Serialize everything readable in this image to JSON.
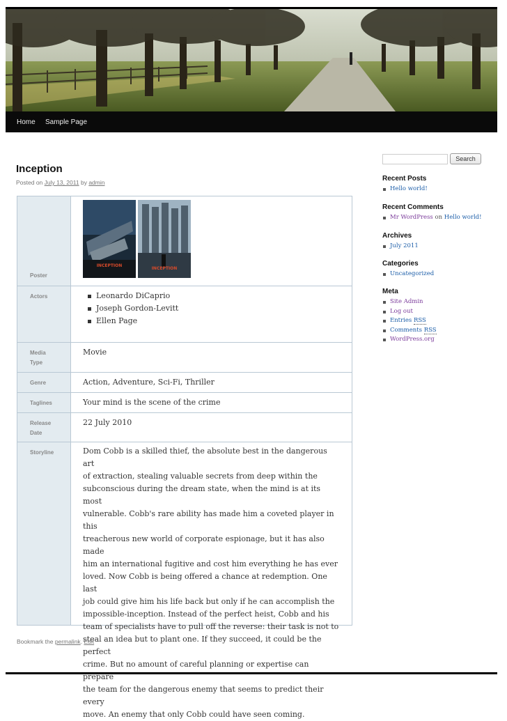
{
  "nav": {
    "items": [
      "Home",
      "Sample Page"
    ]
  },
  "post": {
    "title": "Inception",
    "posted_on": "Posted on",
    "date": "July 13, 2011",
    "by": "by",
    "author": "admin"
  },
  "movie": {
    "labels": {
      "poster": "Poster",
      "actors": "Actors",
      "media_type_1": "Media",
      "media_type_2": "Type",
      "genre": "Genre",
      "taglines": "Taglines",
      "release_1": "Release",
      "release_2": "Date",
      "storyline": "Storyline"
    },
    "poster1_text": "INCEPTION",
    "poster2_text": "INCEPTION",
    "actors": [
      "Leonardo DiCaprio",
      "Joseph Gordon-Levitt",
      "Ellen Page"
    ],
    "media_type": "Movie",
    "genre": "Action, Adventure, Sci-Fi, Thriller",
    "tagline": "Your mind is the scene of the crime",
    "release_date": "22 July 2010",
    "storyline_lines": [
      "Dom Cobb is a skilled thief, the absolute best in the dangerous art",
      "of extraction, stealing valuable secrets from deep within the",
      "subconscious during the dream state, when the mind is at its most",
      "vulnerable. Cobb's rare ability has made him a coveted player in this",
      "treacherous new world of corporate espionage, but it has also made",
      "him an international fugitive and cost him everything he has ever",
      "loved. Now Cobb is being offered a chance at redemption. One last",
      "job could give him his life back but only if he can accomplish the",
      "impossible-inception. Instead of the perfect heist, Cobb and his",
      "team of specialists have to pull off the reverse: their task is not to",
      "steal an idea but to plant one. If they succeed, it could be the perfect",
      "crime. But no amount of careful planning or expertise can prepare",
      "the team for the dangerous enemy that seems to predict their every",
      "move. An enemy that only Cobb could have seen coming."
    ]
  },
  "footer": {
    "bookmark": "Bookmark the",
    "permalink": "permalink",
    "sep": ".",
    "edit": "Edit"
  },
  "sidebar": {
    "search_button": "Search",
    "recent_posts": {
      "title": "Recent Posts",
      "items": [
        "Hello world!"
      ]
    },
    "recent_comments": {
      "title": "Recent Comments",
      "author": "Mr WordPress",
      "on": "on",
      "post": "Hello world!"
    },
    "archives": {
      "title": "Archives",
      "items": [
        "July 2011"
      ]
    },
    "categories": {
      "title": "Categories",
      "items": [
        "Uncategorized"
      ]
    },
    "meta": {
      "title": "Meta",
      "site_admin": "Site Admin",
      "log_out": "Log out",
      "entries": "Entries",
      "comments": "Comments",
      "rss": "RSS",
      "wordpress": "WordPress.org"
    }
  },
  "colors": {
    "link": "#1b5da8",
    "visited": "#7a3a9a",
    "label_bg": "#e3ebf0",
    "border": "#b9c8d4"
  }
}
